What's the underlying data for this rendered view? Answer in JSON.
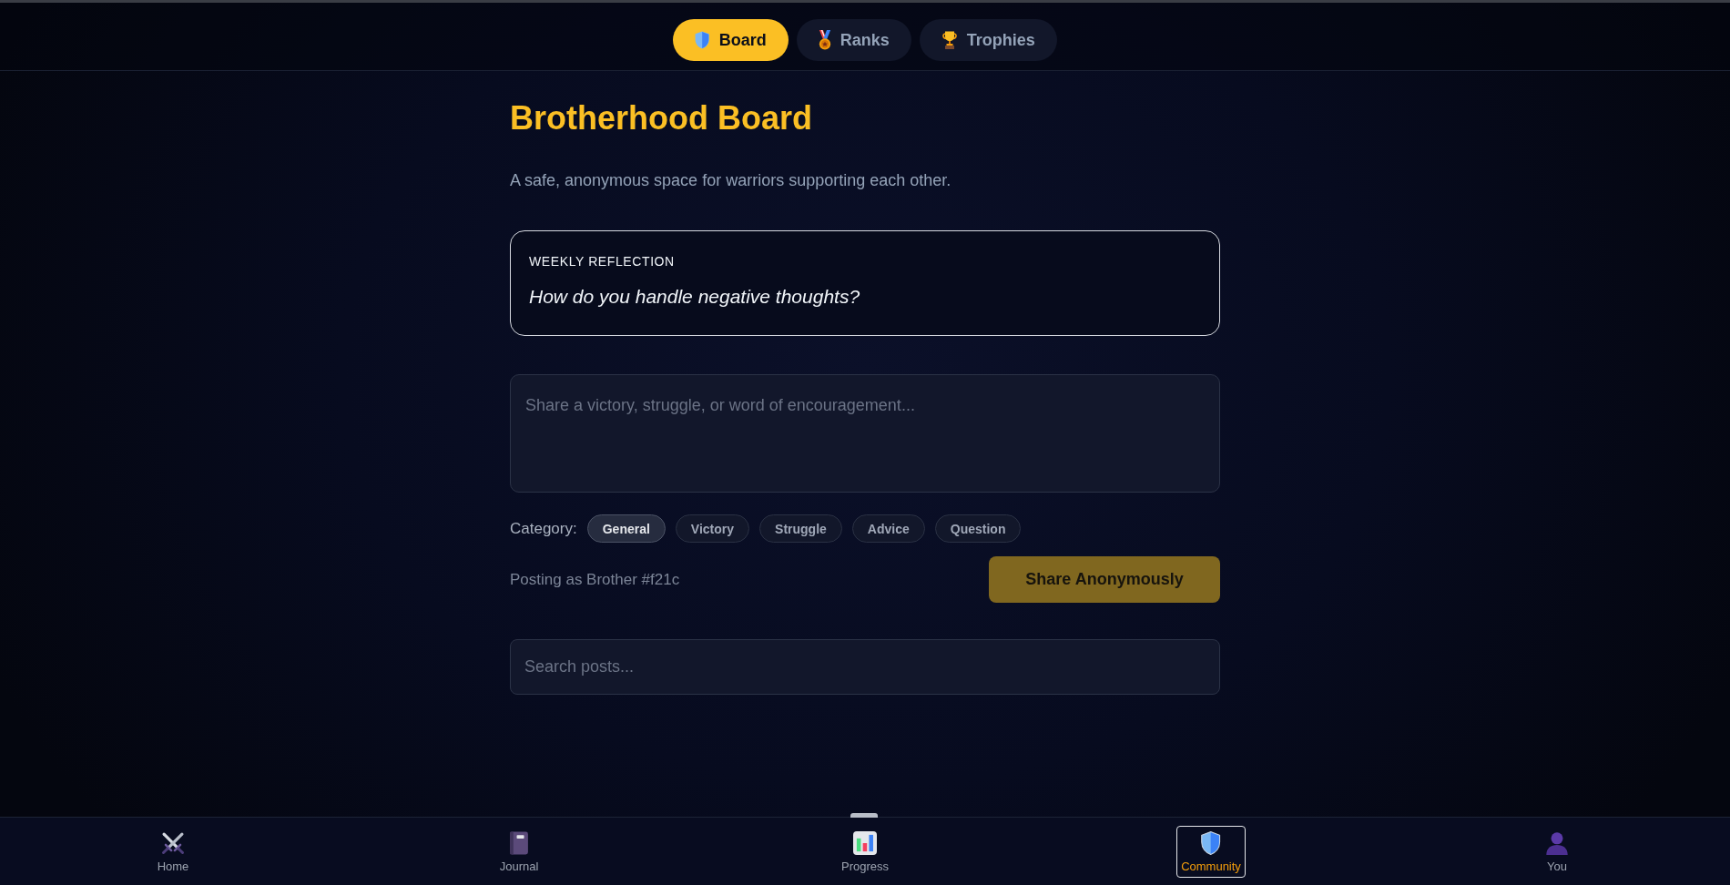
{
  "nav_tabs": [
    {
      "label": "Board",
      "selected": true
    },
    {
      "label": "Ranks",
      "selected": false
    },
    {
      "label": "Trophies",
      "selected": false
    }
  ],
  "page": {
    "title": "Brotherhood Board",
    "subtitle": "A safe, anonymous space for warriors supporting each other."
  },
  "reflection": {
    "label": "WEEKLY REFLECTION",
    "question": "How do you handle negative thoughts?"
  },
  "composer": {
    "placeholder": "Share a victory, struggle, or word of encouragement...",
    "category_label": "Category:",
    "categories": [
      {
        "label": "General",
        "selected": true
      },
      {
        "label": "Victory",
        "selected": false
      },
      {
        "label": "Struggle",
        "selected": false
      },
      {
        "label": "Advice",
        "selected": false
      },
      {
        "label": "Question",
        "selected": false
      }
    ],
    "posting_as": "Posting as Brother #f21c",
    "submit": {
      "label": "Share Anonymously",
      "disabled": true
    }
  },
  "search": {
    "placeholder": "Search posts..."
  },
  "bottom_nav": [
    {
      "label": "Home",
      "selected": false
    },
    {
      "label": "Journal",
      "selected": false
    },
    {
      "label": "Progress",
      "selected": false
    },
    {
      "label": "Community",
      "selected": true
    },
    {
      "label": "You",
      "selected": false
    }
  ]
}
